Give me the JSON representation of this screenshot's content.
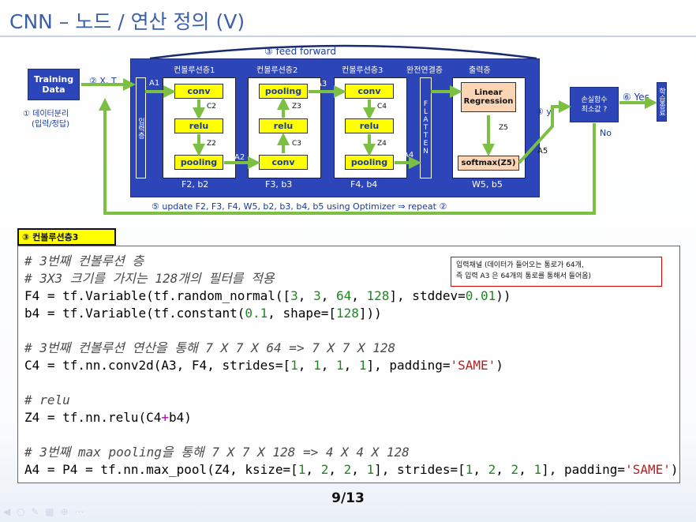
{
  "title": "CNN – 노드 / 연산 정의 (V)",
  "diagram": {
    "feed_forward": "③ feed forward",
    "training_data": "Training Data",
    "step2": "② X, T",
    "step1_line1": "① 데이터분리",
    "step1_line2": "(입력/정답)",
    "input_layer": "입력층",
    "conv1_header": "컨볼루션층1",
    "conv2_header": "컨볼루션층2",
    "conv3_header": "컨볼루션층3",
    "fc_header": "완전연결층",
    "output_header": "출력층",
    "col1": {
      "conv": "conv",
      "relu": "relu",
      "pooling": "pooling",
      "weights": "F2, b2",
      "c": "C2",
      "z": "Z2"
    },
    "col2": {
      "pooling": "pooling",
      "relu": "relu",
      "conv": "conv",
      "weights": "F3, b3",
      "c": "C3",
      "z": "Z3"
    },
    "col3": {
      "conv": "conv",
      "relu": "relu",
      "pooling": "pooling",
      "weights": "F4, b4",
      "c": "C4",
      "z": "Z4"
    },
    "a_labels": {
      "a1": "A1",
      "a2": "A2",
      "a3": "A3",
      "a4": "A4",
      "a5": "A5",
      "z5": "Z5"
    },
    "flatten": "FLATTEN",
    "linear_regression": "Linear Regression",
    "softmax": "softmax(Z5)",
    "out_weights": "W5, b5",
    "step4": "④ y",
    "loss_line1": "손실함수",
    "loss_line2": "최소값 ?",
    "step6": "⑥ Yes",
    "no": "No",
    "finish": "학습종료",
    "update": "⑤ update F2, F3, F4, W5, b2, b3, b4, b5  using Optimizer ⇒  repeat  ②"
  },
  "section_label": "③ 컨볼루션층3",
  "code": {
    "l1": "# 3번째 컨볼루션 층",
    "l2": "# 3X3 크기를 가지는 128개의 필터를 적용",
    "l3": {
      "a": "F4 = tf.Variable(tf.random_normal([",
      "n1": "3",
      "s1": ", ",
      "n2": "3",
      "s2": ", ",
      "n3": "64",
      "s3": ", ",
      "n4": "128",
      "b": "], stddev=",
      "n5": "0.01",
      "c": "))"
    },
    "l4": {
      "a": "b4 = tf.Variable(tf.constant(",
      "n1": "0.1",
      "b": ", shape=[",
      "n2": "128",
      "c": "]))"
    },
    "l5": "# 3번째 컨볼루션 연산을 통해 7 X 7 X 64 => 7 X 7 X 128",
    "l6": {
      "a": "C4 = tf.nn.conv2d(A3, F4, strides=[",
      "n1": "1",
      "s1": ", ",
      "n2": "1",
      "s2": ", ",
      "n3": "1",
      "s3": ", ",
      "n4": "1",
      "b": "], padding=",
      "str": "'SAME'",
      "c": ")"
    },
    "l7": "# relu",
    "l8": {
      "a": "Z4 = tf.nn.relu(C4",
      "op": "+",
      "b": "b4)"
    },
    "l9": "# 3번째 max pooling을 통해 7 X 7 X 128 => 4 X 4 X 128",
    "l10": {
      "a": "A4 = P4 = tf.nn.max_pool(Z4, ksize=[",
      "n1": "1",
      "s1": ", ",
      "n2": "2",
      "s2": ", ",
      "n3": "2",
      "s3": ", ",
      "n4": "1",
      "b": "], strides=[",
      "m1": "1",
      "t1": ", ",
      "m2": "2",
      "t2": ", ",
      "m3": "2",
      "t3": ", ",
      "m4": "1",
      "c": "], padding=",
      "str": "'SAME'",
      "d": ")"
    }
  },
  "callout": {
    "line1": "입력채널 (데이터가 들어오는 통로가 64개,",
    "line2": "즉 입력  A3 은 64개의 통로를 통해서 들어옴)"
  },
  "page_number": "9/13",
  "colors": {
    "panel": "#2c45b8",
    "arrow": "#7bc043",
    "highlight": "#ffff00",
    "callout_border": "#e00000"
  }
}
